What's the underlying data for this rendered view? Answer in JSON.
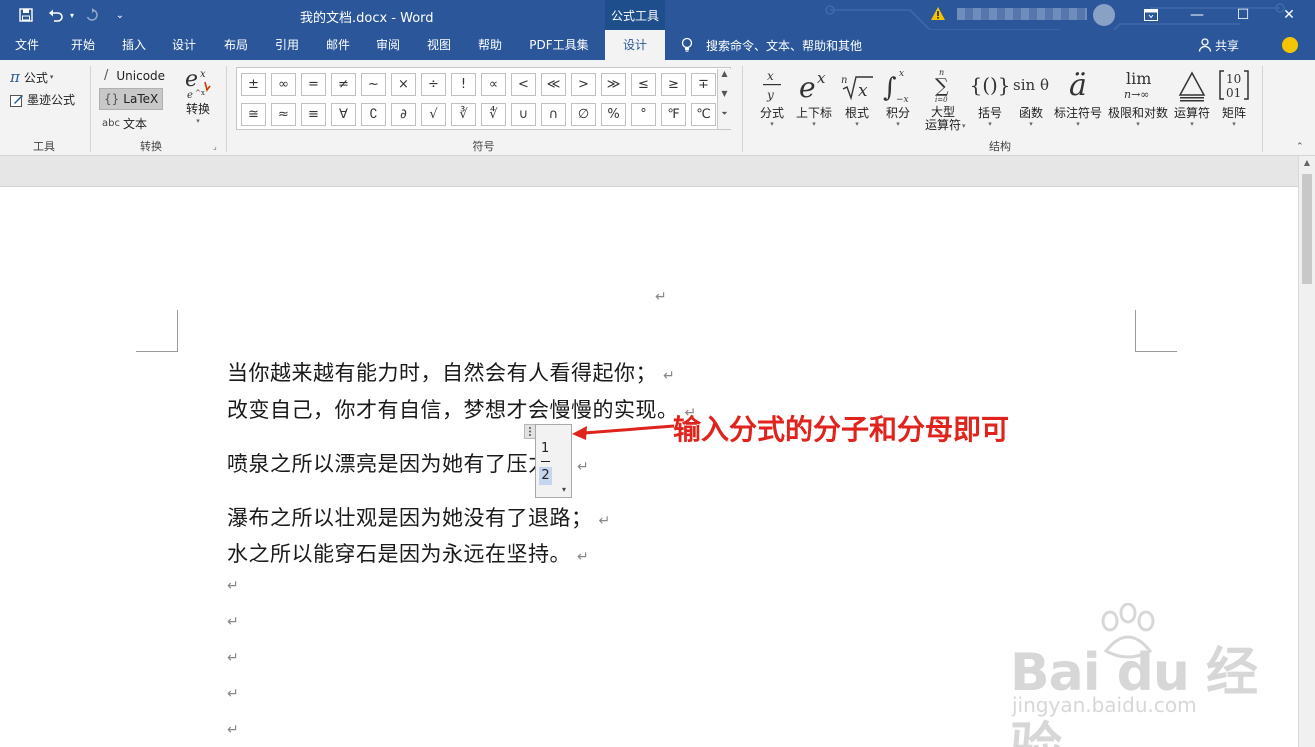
{
  "titlebar": {
    "doc_title": "我的文档.docx  -  Word",
    "context_tab": "公式工具",
    "win_ribbon_icon": "ribbon-display-icon",
    "win_min": "—",
    "win_max": "☐",
    "win_close": "✕"
  },
  "tabs": [
    {
      "label": "文件"
    },
    {
      "label": "开始"
    },
    {
      "label": "插入"
    },
    {
      "label": "设计"
    },
    {
      "label": "布局"
    },
    {
      "label": "引用"
    },
    {
      "label": "邮件"
    },
    {
      "label": "审阅"
    },
    {
      "label": "视图"
    },
    {
      "label": "帮助"
    },
    {
      "label": "PDF工具集"
    },
    {
      "label": "设计"
    }
  ],
  "tellme": "搜索命令、文本、帮助和其他",
  "share": "共享",
  "ribbon": {
    "tools": {
      "equation": "公式",
      "ink_equation": "墨迹公式",
      "label": "工具"
    },
    "convert": {
      "unicode": "Unicode",
      "latex": "LaTeX",
      "text": "文本",
      "convert_btn": "转换",
      "label": "转换",
      "abc": "abc",
      "unicode_glyph": "/",
      "latex_glyph": "{}"
    },
    "symbols": {
      "row1": [
        "±",
        "∞",
        "=",
        "≠",
        "~",
        "×",
        "÷",
        "!",
        "∝",
        "<",
        "≪",
        ">",
        "≫",
        "≤",
        "≥",
        "∓"
      ],
      "row2": [
        "≅",
        "≈",
        "≡",
        "∀",
        "∁",
        "∂",
        "√",
        "∛",
        "∜",
        "∪",
        "∩",
        "∅",
        "%",
        "°",
        "℉",
        "℃"
      ],
      "label": "符号"
    },
    "structures": {
      "items": [
        {
          "label": "分式"
        },
        {
          "label": "上下标"
        },
        {
          "label": "根式"
        },
        {
          "label": "积分"
        },
        {
          "label": "大型\n运算符"
        },
        {
          "label": "括号"
        },
        {
          "label": "函数"
        },
        {
          "label": "标注符号"
        },
        {
          "label": "极限和对数"
        },
        {
          "label": "运算符"
        },
        {
          "label": "矩阵"
        }
      ],
      "label": "结构"
    }
  },
  "document": {
    "paragraphs": [
      "当你越来越有能力时，自然会有人看得起你；",
      "改变自己，你才有自信，梦想才会慢慢的实现。",
      "喷泉之所以漂亮是因为她有了压力；",
      "瀑布之所以壮观是因为她没有了退路；",
      "水之所以能穿石是因为永远在坚持。"
    ],
    "paragraph_mark": "↵",
    "equation": {
      "numerator": "1",
      "denominator": "2"
    }
  },
  "annotation": {
    "text": "输入分式的分子和分母即可",
    "color": "#e0231c"
  },
  "watermark": {
    "brand": "Bai du 经验",
    "url": "jingyan.baidu.com"
  },
  "colors": {
    "title_bar": "#2b579a",
    "ribbon_bg": "#f3f3f3",
    "accent": "#2b579a"
  }
}
